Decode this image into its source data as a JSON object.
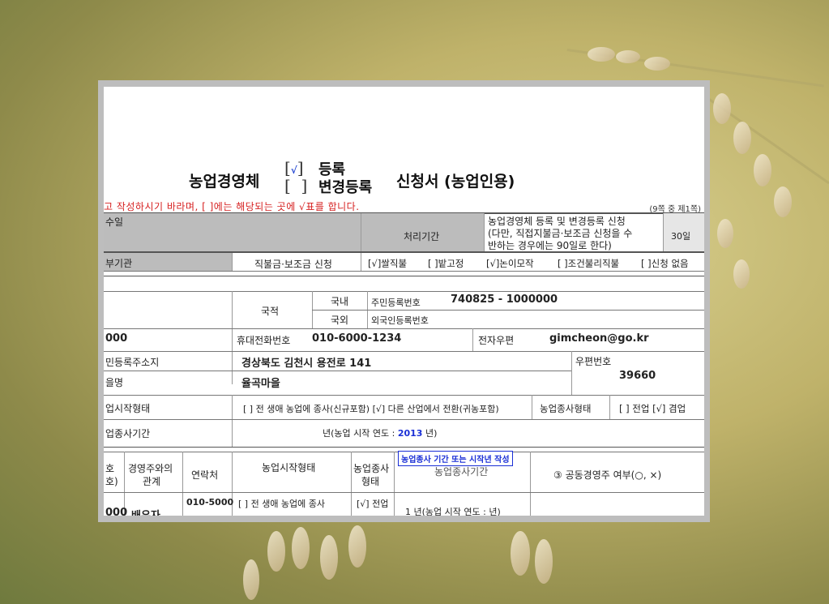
{
  "form": {
    "title_left": "농업경영체",
    "checkbox_open": "[",
    "checkbox_close": "]",
    "checkbox_register_mark": "√",
    "option_register": "등록",
    "option_change": "변경등록",
    "title_right": "신청서 (농업인용)",
    "notice_text": "고 작성하시기 바라며, [   ]에는 해당되는 곳에 √표를 합니다.",
    "page_info": "(9쪽 중 제1쪽)"
  },
  "receipt": {
    "label": "수일",
    "processing_period_label": "처리기간",
    "processing_note_line1": "농업경영체 등록 및 변경등록 신청",
    "processing_note_line2": "(다만, 직접지불금·보조금 신청을 수",
    "processing_note_line3": "반하는 경우에는 90일로 한다)",
    "processing_days": "30일"
  },
  "subsidy": {
    "org_label": "부기관",
    "apply_label": "직불금·보조금 신청",
    "rice": "[√]쌀직불",
    "field": "[ ]밭고정",
    "paddy": "[√]논이모작",
    "conditional": "[ ]조건불리직불",
    "none": "[ ]신청 없음"
  },
  "applicant": {
    "nationality_label": "국적",
    "domestic_label": "국내",
    "foreign_label": "국외",
    "resident_no_label": "주민등록번호",
    "resident_no": "740825 - 1000000",
    "foreigner_no_label": "외국인등록번호",
    "phone_partial": "000",
    "mobile_label": "휴대전화번호",
    "mobile": "010-6000-1234",
    "email_label": "전자우편",
    "email": "gimcheon@go.kr",
    "address_label": "민등록주소지",
    "address": "경상북도 김천시 용전로 141",
    "postcode_label": "우편번호",
    "postcode": "39660",
    "village_label": "을명",
    "village": "율곡마을",
    "start_type_label": "업시작형태",
    "start_type_value": "[ ] 전 생애 농업에 종사(신규포함)  [√] 다른 산업에서 전환(귀농포함)",
    "work_type_label": "농업종사형태",
    "work_type_value": "[ ] 전업 [√] 겸업",
    "period_label": "업종사기간",
    "period_prefix": "년(농업 시작 연도 : ",
    "period_year": "2013",
    "period_suffix": " 년)"
  },
  "comanager": {
    "col_no_1": "호",
    "col_no_2": "호)",
    "col_relation_1": "경영주와의",
    "col_relation_2": "관계",
    "col_contact": "연락처",
    "col_start_type": "농업시작형태",
    "col_work_type_1": "농업종사",
    "col_work_type_2": "형태",
    "col_period": "농업종사기간",
    "col_co_owner": "③ 공동경영주 여부(○, ×)",
    "annotation": "농업종사 기간 또는 시작년 작성",
    "row_no": "000",
    "row_relation": "배우자",
    "row_contact": "010-5000",
    "row_start_type": "[ ] 전 생애 농업에 종사",
    "row_work_type": "[√] 전업",
    "row_period": "1  년(농업 시작 연도 :      년)"
  }
}
